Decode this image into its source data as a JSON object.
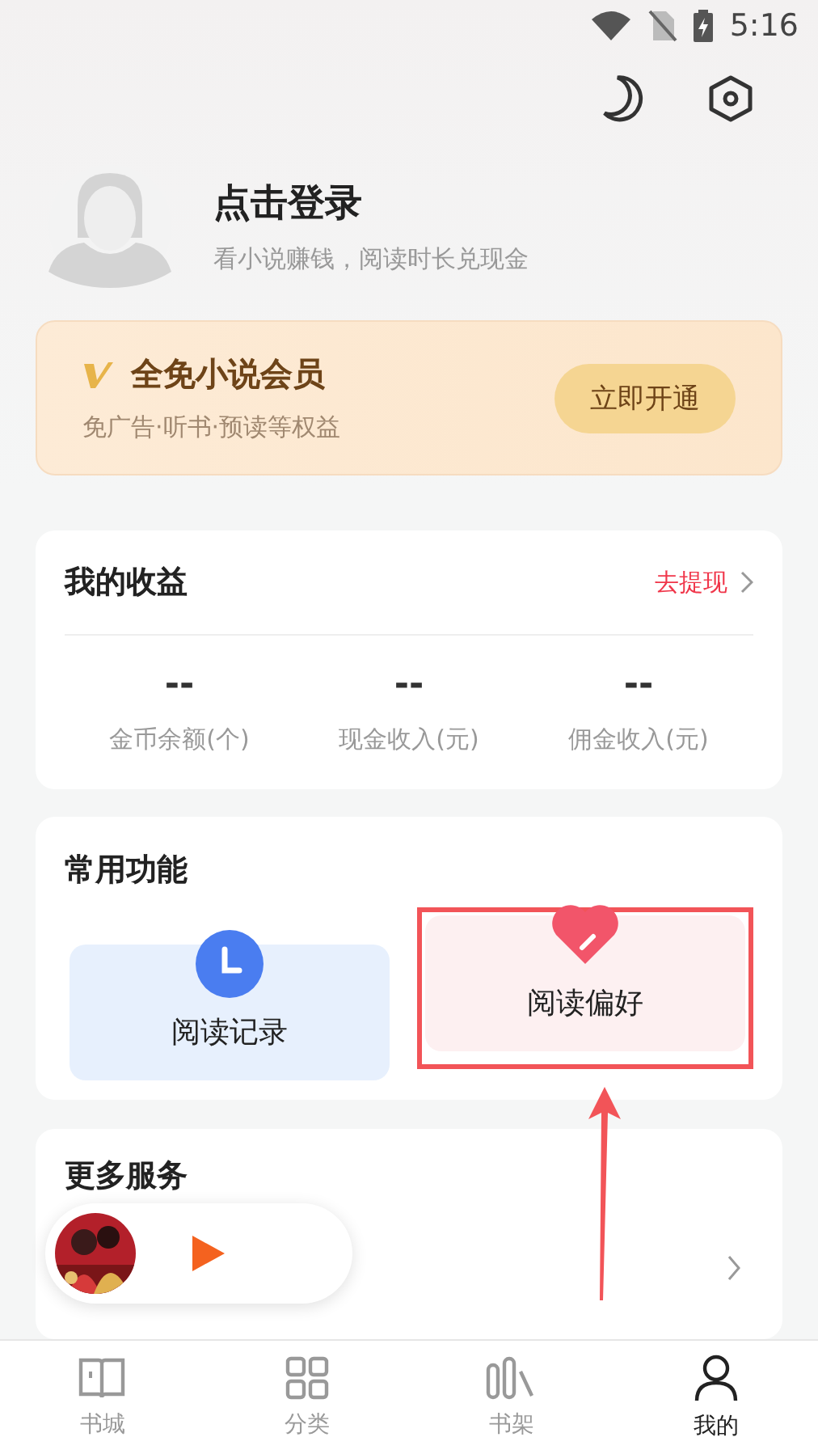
{
  "status_bar": {
    "time": "5:16"
  },
  "profile": {
    "title": "点击登录",
    "subtitle": "看小说赚钱，阅读时长兑现金"
  },
  "vip": {
    "title": "全免小说会员",
    "subtitle": "免广告·听书·预读等权益",
    "button": "立即开通"
  },
  "earnings": {
    "title": "我的收益",
    "link": "去提现",
    "stats": [
      {
        "value": "--",
        "label": "金币余额(个)"
      },
      {
        "value": "--",
        "label": "现金收入(元)"
      },
      {
        "value": "--",
        "label": "佣金收入(元)"
      }
    ]
  },
  "functions": {
    "title": "常用功能",
    "items": [
      {
        "label": "阅读记录",
        "kind": "clock",
        "highlighted": false
      },
      {
        "label": "阅读偏好",
        "kind": "heart",
        "highlighted": true
      }
    ]
  },
  "services": {
    "title": "更多服务"
  },
  "tabs": [
    {
      "label": "书城",
      "kind": "book",
      "selected": false
    },
    {
      "label": "分类",
      "kind": "grid",
      "selected": false
    },
    {
      "label": "书架",
      "kind": "shelf",
      "selected": false
    },
    {
      "label": "我的",
      "kind": "person",
      "selected": true
    }
  ]
}
